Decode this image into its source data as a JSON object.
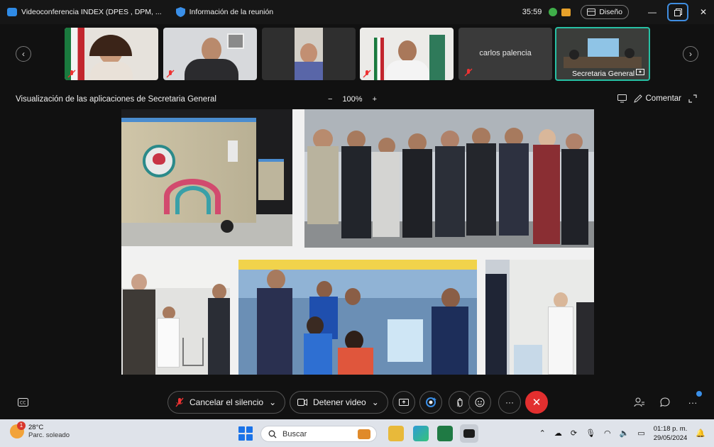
{
  "window": {
    "title": "Videoconferencia INDEX (DPES , DPM, ...",
    "info_label": "Información de la reunión",
    "timer": "35:59",
    "layout_label": "Diseño"
  },
  "participants": [
    {
      "name": "",
      "muted": true
    },
    {
      "name": "",
      "muted": true
    },
    {
      "name": "",
      "muted": false
    },
    {
      "name": "",
      "muted": true
    },
    {
      "name": "carlos palencia",
      "muted": true
    },
    {
      "name": "Secretaria General",
      "muted": false,
      "sharing": true
    }
  ],
  "share": {
    "title": "Visualización de las aplicaciones de Secretaria General",
    "zoom_minus": "−",
    "zoom_level": "100%",
    "zoom_plus": "+",
    "comment_label": "Comentar"
  },
  "controls": {
    "unmute_label": "Cancelar el silencio",
    "stop_video_label": "Detener video"
  },
  "taskbar": {
    "temperature": "28°C",
    "weather": "Parc. soleado",
    "weather_badge": "1",
    "search_placeholder": "Buscar",
    "time": "01:18 p. m.",
    "date": "29/05/2024"
  },
  "colors": {
    "accent": "#27c0a4",
    "end_call": "#e22f2f",
    "brand": "#2f8be6"
  }
}
